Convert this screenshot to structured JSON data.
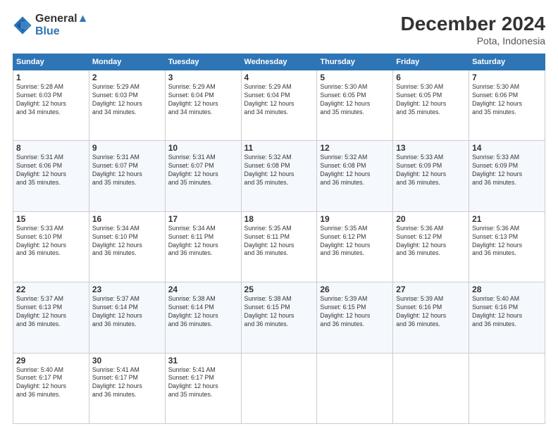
{
  "header": {
    "logo_line1": "General",
    "logo_line2": "Blue",
    "month": "December 2024",
    "location": "Pota, Indonesia"
  },
  "days_of_week": [
    "Sunday",
    "Monday",
    "Tuesday",
    "Wednesday",
    "Thursday",
    "Friday",
    "Saturday"
  ],
  "weeks": [
    [
      {
        "day": "1",
        "info": "Sunrise: 5:28 AM\nSunset: 6:03 PM\nDaylight: 12 hours\nand 34 minutes."
      },
      {
        "day": "2",
        "info": "Sunrise: 5:29 AM\nSunset: 6:03 PM\nDaylight: 12 hours\nand 34 minutes."
      },
      {
        "day": "3",
        "info": "Sunrise: 5:29 AM\nSunset: 6:04 PM\nDaylight: 12 hours\nand 34 minutes."
      },
      {
        "day": "4",
        "info": "Sunrise: 5:29 AM\nSunset: 6:04 PM\nDaylight: 12 hours\nand 34 minutes."
      },
      {
        "day": "5",
        "info": "Sunrise: 5:30 AM\nSunset: 6:05 PM\nDaylight: 12 hours\nand 35 minutes."
      },
      {
        "day": "6",
        "info": "Sunrise: 5:30 AM\nSunset: 6:05 PM\nDaylight: 12 hours\nand 35 minutes."
      },
      {
        "day": "7",
        "info": "Sunrise: 5:30 AM\nSunset: 6:06 PM\nDaylight: 12 hours\nand 35 minutes."
      }
    ],
    [
      {
        "day": "8",
        "info": "Sunrise: 5:31 AM\nSunset: 6:06 PM\nDaylight: 12 hours\nand 35 minutes."
      },
      {
        "day": "9",
        "info": "Sunrise: 5:31 AM\nSunset: 6:07 PM\nDaylight: 12 hours\nand 35 minutes."
      },
      {
        "day": "10",
        "info": "Sunrise: 5:31 AM\nSunset: 6:07 PM\nDaylight: 12 hours\nand 35 minutes."
      },
      {
        "day": "11",
        "info": "Sunrise: 5:32 AM\nSunset: 6:08 PM\nDaylight: 12 hours\nand 35 minutes."
      },
      {
        "day": "12",
        "info": "Sunrise: 5:32 AM\nSunset: 6:08 PM\nDaylight: 12 hours\nand 36 minutes."
      },
      {
        "day": "13",
        "info": "Sunrise: 5:33 AM\nSunset: 6:09 PM\nDaylight: 12 hours\nand 36 minutes."
      },
      {
        "day": "14",
        "info": "Sunrise: 5:33 AM\nSunset: 6:09 PM\nDaylight: 12 hours\nand 36 minutes."
      }
    ],
    [
      {
        "day": "15",
        "info": "Sunrise: 5:33 AM\nSunset: 6:10 PM\nDaylight: 12 hours\nand 36 minutes."
      },
      {
        "day": "16",
        "info": "Sunrise: 5:34 AM\nSunset: 6:10 PM\nDaylight: 12 hours\nand 36 minutes."
      },
      {
        "day": "17",
        "info": "Sunrise: 5:34 AM\nSunset: 6:11 PM\nDaylight: 12 hours\nand 36 minutes."
      },
      {
        "day": "18",
        "info": "Sunrise: 5:35 AM\nSunset: 6:11 PM\nDaylight: 12 hours\nand 36 minutes."
      },
      {
        "day": "19",
        "info": "Sunrise: 5:35 AM\nSunset: 6:12 PM\nDaylight: 12 hours\nand 36 minutes."
      },
      {
        "day": "20",
        "info": "Sunrise: 5:36 AM\nSunset: 6:12 PM\nDaylight: 12 hours\nand 36 minutes."
      },
      {
        "day": "21",
        "info": "Sunrise: 5:36 AM\nSunset: 6:13 PM\nDaylight: 12 hours\nand 36 minutes."
      }
    ],
    [
      {
        "day": "22",
        "info": "Sunrise: 5:37 AM\nSunset: 6:13 PM\nDaylight: 12 hours\nand 36 minutes."
      },
      {
        "day": "23",
        "info": "Sunrise: 5:37 AM\nSunset: 6:14 PM\nDaylight: 12 hours\nand 36 minutes."
      },
      {
        "day": "24",
        "info": "Sunrise: 5:38 AM\nSunset: 6:14 PM\nDaylight: 12 hours\nand 36 minutes."
      },
      {
        "day": "25",
        "info": "Sunrise: 5:38 AM\nSunset: 6:15 PM\nDaylight: 12 hours\nand 36 minutes."
      },
      {
        "day": "26",
        "info": "Sunrise: 5:39 AM\nSunset: 6:15 PM\nDaylight: 12 hours\nand 36 minutes."
      },
      {
        "day": "27",
        "info": "Sunrise: 5:39 AM\nSunset: 6:16 PM\nDaylight: 12 hours\nand 36 minutes."
      },
      {
        "day": "28",
        "info": "Sunrise: 5:40 AM\nSunset: 6:16 PM\nDaylight: 12 hours\nand 36 minutes."
      }
    ],
    [
      {
        "day": "29",
        "info": "Sunrise: 5:40 AM\nSunset: 6:17 PM\nDaylight: 12 hours\nand 36 minutes."
      },
      {
        "day": "30",
        "info": "Sunrise: 5:41 AM\nSunset: 6:17 PM\nDaylight: 12 hours\nand 36 minutes."
      },
      {
        "day": "31",
        "info": "Sunrise: 5:41 AM\nSunset: 6:17 PM\nDaylight: 12 hours\nand 35 minutes."
      },
      null,
      null,
      null,
      null
    ]
  ]
}
